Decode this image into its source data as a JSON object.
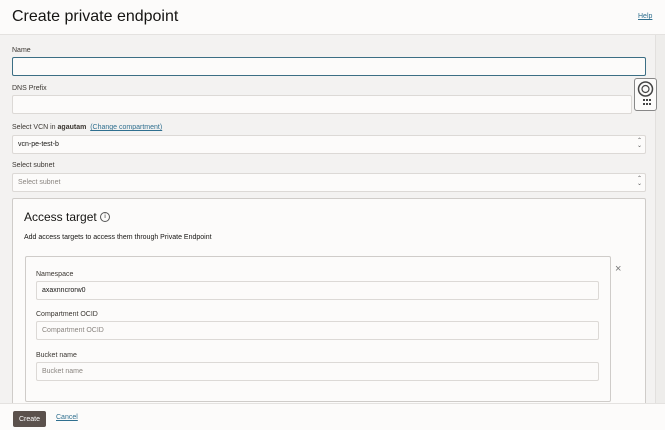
{
  "header": {
    "title": "Create private endpoint",
    "help": "Help"
  },
  "form": {
    "name_label": "Name",
    "name_value": "",
    "dns_label": "DNS Prefix",
    "dns_value": "",
    "vcn_label_prefix": "Select VCN in",
    "vcn_compartment": "agautam",
    "vcn_change": "(Change compartment)",
    "vcn_value": "vcn-pe-test-b",
    "subnet_label": "Select subnet",
    "subnet_placeholder": "Select subnet"
  },
  "access_target": {
    "title": "Access target",
    "info_icon": "i",
    "description": "Add access targets to access them through Private Endpoint",
    "namespace_label": "Namespace",
    "namespace_value": "axaxnncrorw0",
    "compartment_label": "Compartment OCID",
    "compartment_placeholder": "Compartment OCID",
    "bucket_label": "Bucket name",
    "bucket_placeholder": "Bucket name",
    "close": "×"
  },
  "footer": {
    "create": "Create",
    "cancel": "Cancel"
  },
  "colors": {
    "accent": "#3b6e84",
    "primary_button": "#5b514c",
    "link": "#2f6f8f"
  }
}
